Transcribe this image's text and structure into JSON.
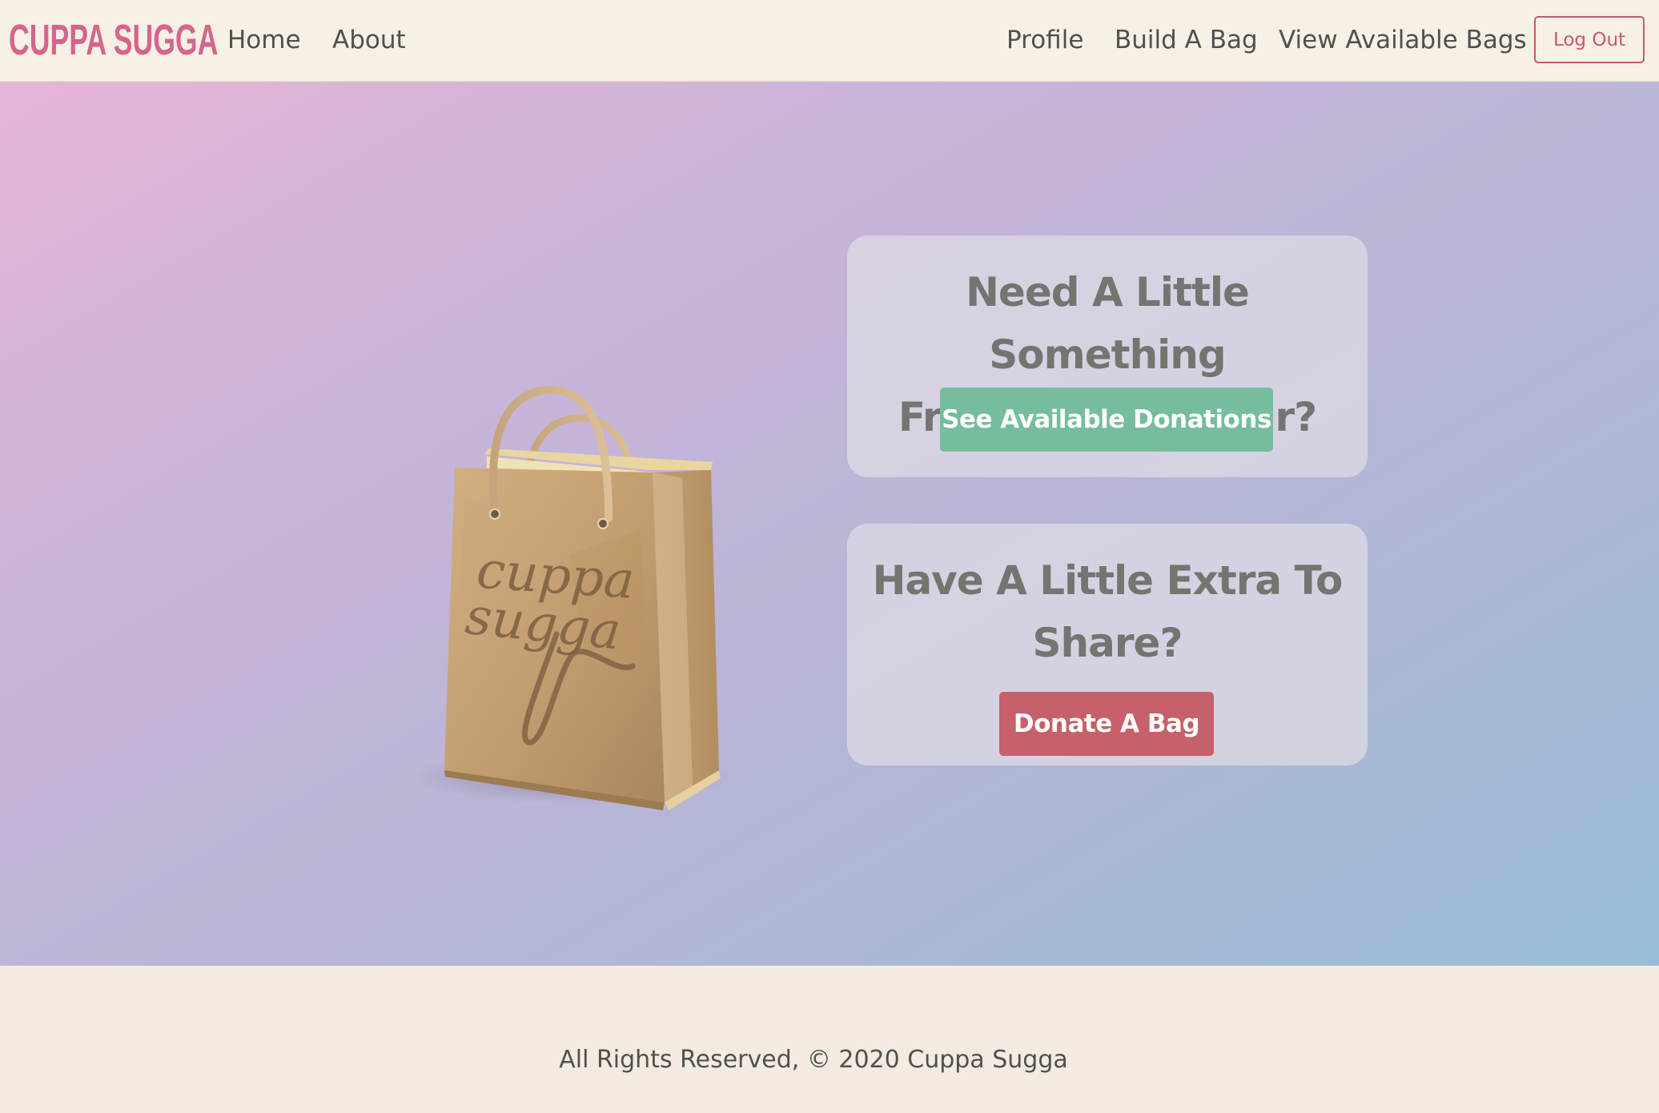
{
  "nav": {
    "brand": "CUPPA SUGGA",
    "left_links": [
      "Home",
      "About"
    ],
    "right_links": [
      "Profile",
      "Build A Bag",
      "View Available Bags"
    ],
    "logout_label": "Log Out"
  },
  "hero": {
    "bag_text_line1": "cuppa",
    "bag_text_line2": "sugga",
    "need_card": {
      "title_line1": "Need A Little Something",
      "title_line2": "From A Neighbour?",
      "button_label": "See Available Donations"
    },
    "give_card": {
      "title_line1": "Have A Little Extra To",
      "title_line2": "Share?",
      "button_label": "Donate A Bag"
    }
  },
  "footer": {
    "text": "All Rights Reserved, © 2020 Cuppa Sugga"
  },
  "colors": {
    "brand": "#d5648e",
    "nav_bg": "#f7f0e4",
    "green_button": "#75bd9d",
    "red_button": "#c6606a",
    "logout_border": "#c55a67"
  }
}
